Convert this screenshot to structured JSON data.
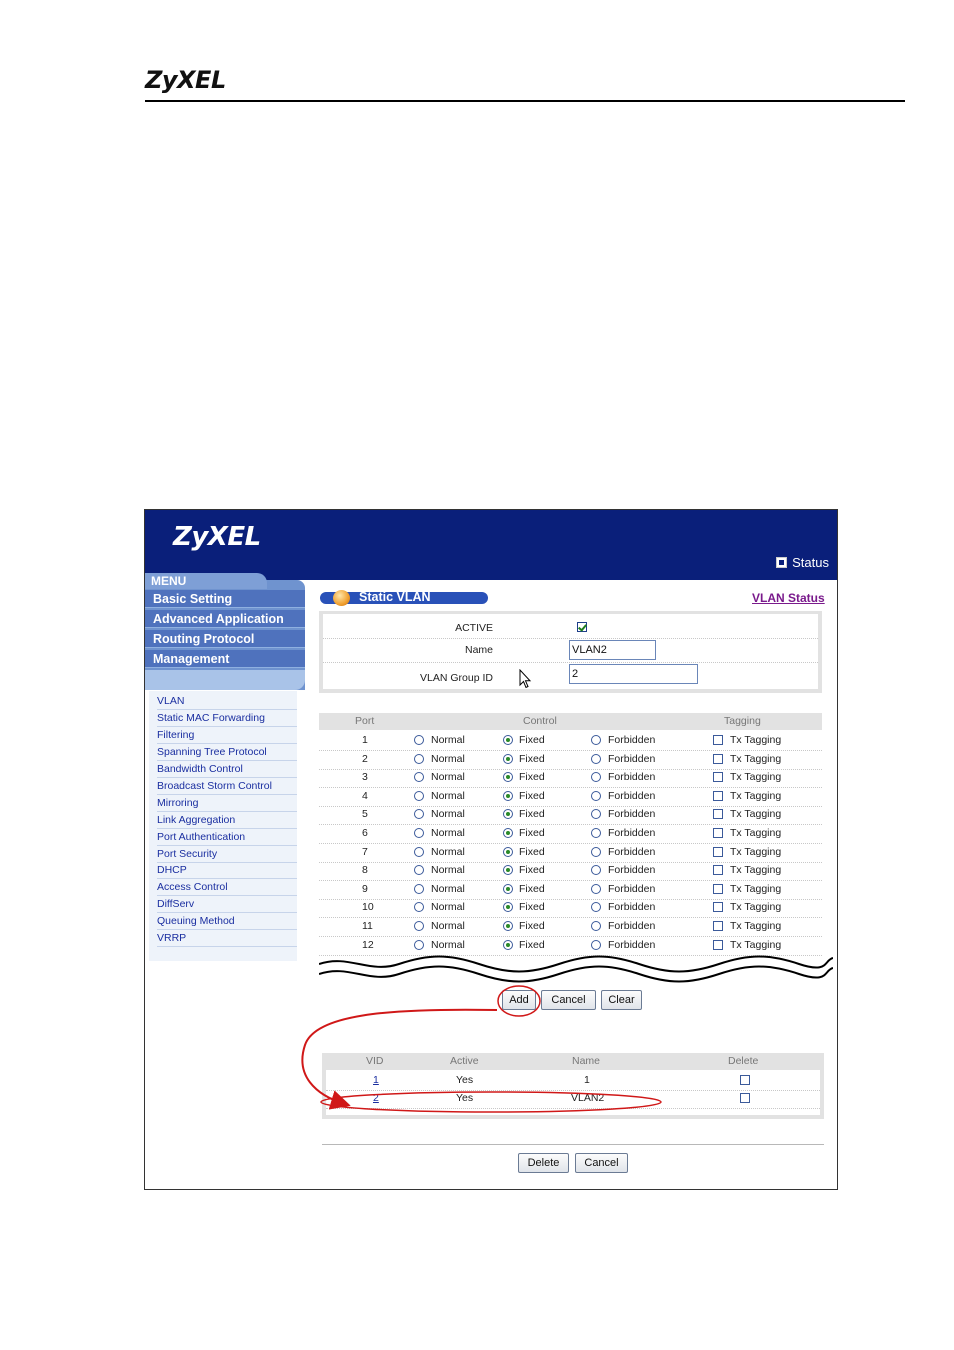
{
  "document": {
    "logo": "ZyXEL"
  },
  "banner": {
    "logo": "ZyXEL",
    "status_label": "Status"
  },
  "menu": {
    "header": "MENU",
    "items": [
      "Basic Setting",
      "Advanced Application",
      "Routing Protocol",
      "Management"
    ],
    "submenu": [
      "VLAN",
      "Static MAC Forwarding",
      "Filtering",
      "Spanning Tree Protocol",
      "Bandwidth Control",
      "Broadcast Storm Control",
      "Mirroring",
      "Link Aggregation",
      "Port Authentication",
      "Port Security",
      "DHCP",
      "Access Control",
      "DiffServ",
      "Queuing Method",
      "VRRP"
    ]
  },
  "page": {
    "title": "Static VLAN",
    "status_link": "VLAN Status"
  },
  "form": {
    "active_label": "ACTIVE",
    "active_checked": true,
    "name_label": "Name",
    "name_value": "VLAN2",
    "group_label": "VLAN Group ID",
    "group_value": "2"
  },
  "port_table": {
    "headers": {
      "port": "Port",
      "control": "Control",
      "tagging": "Tagging"
    },
    "option_normal": "Normal",
    "option_fixed": "Fixed",
    "option_forbidden": "Forbidden",
    "tag_label": "Tx Tagging",
    "rows": [
      {
        "port": "1",
        "control": "Fixed",
        "tagged": false
      },
      {
        "port": "2",
        "control": "Fixed",
        "tagged": false
      },
      {
        "port": "3",
        "control": "Fixed",
        "tagged": false
      },
      {
        "port": "4",
        "control": "Fixed",
        "tagged": false
      },
      {
        "port": "5",
        "control": "Fixed",
        "tagged": false
      },
      {
        "port": "6",
        "control": "Fixed",
        "tagged": false
      },
      {
        "port": "7",
        "control": "Fixed",
        "tagged": false
      },
      {
        "port": "8",
        "control": "Fixed",
        "tagged": false
      },
      {
        "port": "9",
        "control": "Fixed",
        "tagged": false
      },
      {
        "port": "10",
        "control": "Fixed",
        "tagged": false
      },
      {
        "port": "11",
        "control": "Fixed",
        "tagged": false
      },
      {
        "port": "12",
        "control": "Fixed",
        "tagged": false
      }
    ]
  },
  "buttons": {
    "add": "Add",
    "cancel": "Cancel",
    "clear": "Clear",
    "delete": "Delete",
    "cancel2": "Cancel"
  },
  "vid_table": {
    "headers": {
      "vid": "VID",
      "active": "Active",
      "name": "Name",
      "delete": "Delete"
    },
    "rows": [
      {
        "vid": "1",
        "active": "Yes",
        "name": "1",
        "delete": false
      },
      {
        "vid": "2",
        "active": "Yes",
        "name": "VLAN2",
        "delete": false
      }
    ]
  },
  "colors": {
    "banner": "#0a1f7a",
    "menu": "#4f72bd",
    "link": "#1a2ea0",
    "annotation": "#d01818",
    "fixed_radio": "#2a8a2a"
  }
}
